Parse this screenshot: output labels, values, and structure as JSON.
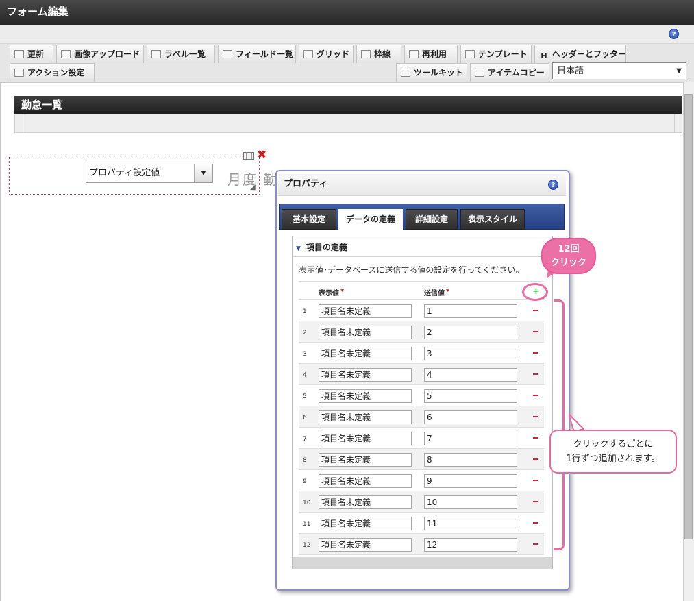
{
  "window": {
    "title": "フォーム編集"
  },
  "help": {
    "glyph": "?"
  },
  "toolbar": {
    "row1": [
      "更新",
      "画像アップロード",
      "ラベル一覧",
      "フィールド一覧",
      "グリッド",
      "枠線",
      "再利用",
      "テンプレート",
      "ヘッダーとフッター"
    ],
    "row1_icons": [
      "update-icon",
      "image-upload-icon",
      "label-list-icon",
      "field-list-icon",
      "grid-icon",
      "border-icon",
      "reuse-icon",
      "template-icon",
      "header-footer-icon"
    ],
    "header_footer_glyph": "H",
    "row2_left": "アクション設定",
    "toolkit": "ツールキット",
    "item_copy": "アイテムコピー",
    "language": "日本語"
  },
  "form": {
    "title": "勤怠一覧",
    "select_value": "プロパティ設定値",
    "bg_label": "月度 勤"
  },
  "dialog": {
    "title": "プロパティ",
    "tabs": [
      "基本設定",
      "データの定義",
      "詳細設定",
      "表示スタイル"
    ],
    "active_tab": "データの定義",
    "section_title": "項目の定義",
    "description": "表示値･データベースに送信する値の設定を行ってください。",
    "col_display": "表示値",
    "col_send": "送信値",
    "required_mark": "*",
    "rows": [
      {
        "no": "1",
        "display": "項目名未定義",
        "send": "1"
      },
      {
        "no": "2",
        "display": "項目名未定義",
        "send": "2"
      },
      {
        "no": "3",
        "display": "項目名未定義",
        "send": "3"
      },
      {
        "no": "4",
        "display": "項目名未定義",
        "send": "4"
      },
      {
        "no": "5",
        "display": "項目名未定義",
        "send": "5"
      },
      {
        "no": "6",
        "display": "項目名未定義",
        "send": "6"
      },
      {
        "no": "7",
        "display": "項目名未定義",
        "send": "7"
      },
      {
        "no": "8",
        "display": "項目名未定義",
        "send": "8"
      },
      {
        "no": "9",
        "display": "項目名未定義",
        "send": "9"
      },
      {
        "no": "10",
        "display": "項目名未定義",
        "send": "10"
      },
      {
        "no": "11",
        "display": "項目名未定義",
        "send": "11"
      },
      {
        "no": "12",
        "display": "項目名未定義",
        "send": "12"
      }
    ],
    "plus_glyph": "+"
  },
  "annotations": {
    "click_count_line1": "12回",
    "click_count_line2": "クリック",
    "note_line1": "クリックするごとに",
    "note_line2": "1行ずつ追加されます。",
    "accent_color": "#e86aa0"
  },
  "glyphs": {
    "dropdown": "▼",
    "close": "✖",
    "collapse": "▼"
  }
}
